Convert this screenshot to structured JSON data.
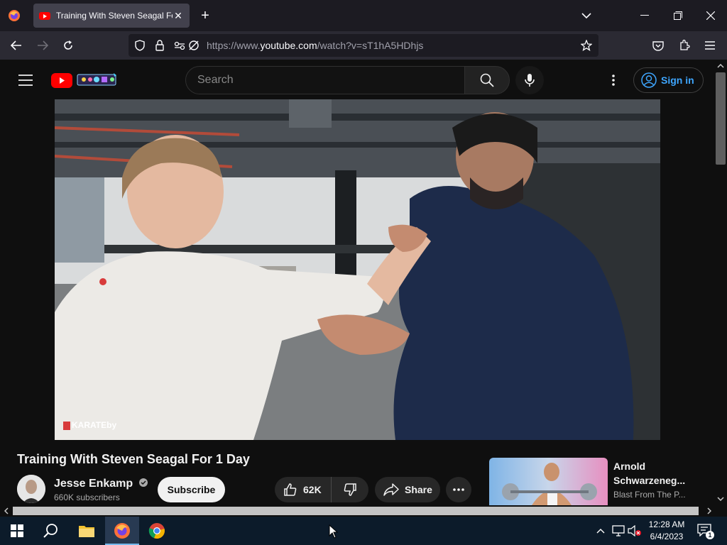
{
  "browser": {
    "tab_title": "Training With Steven Seagal For 1 Day",
    "url_prefix": "https://www.",
    "url_domain": "youtube.com",
    "url_path": "/watch?v=sT1hA5HDhjs"
  },
  "youtube": {
    "search_placeholder": "Search",
    "sign_in_label": "Sign in",
    "video_watermark": "KARATEby",
    "video_title": "Training With Steven Seagal For 1 Day",
    "channel_name": "Jesse Enkamp",
    "subscribers": "660K subscribers",
    "subscribe_label": "Subscribe",
    "like_count": "62K",
    "share_label": "Share",
    "recommendation": {
      "title": "Arnold Schwarzeneg...",
      "channel": "Blast From The P..."
    }
  },
  "taskbar": {
    "time": "12:28 AM",
    "date": "6/4/2023",
    "notification_count": "1"
  },
  "colors": {
    "youtube_red": "#ff0000",
    "link_blue": "#3ea6ff",
    "page_bg": "#0f0f0f"
  }
}
